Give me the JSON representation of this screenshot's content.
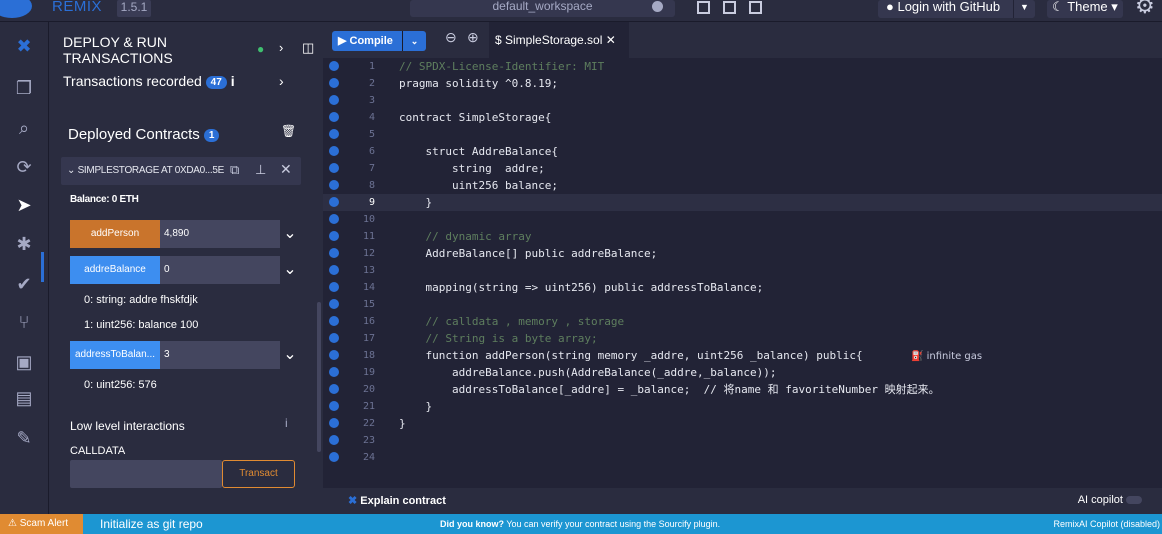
{
  "app": {
    "brand": "REMIX",
    "version": "1.5.1",
    "workspace": "default_workspace",
    "login": "Login with GitHub",
    "theme": "Theme"
  },
  "panel": {
    "title": "DEPLOY & RUN TRANSACTIONS",
    "transactions_label": "Transactions recorded",
    "transactions_count": "47",
    "deployed_label": "Deployed Contracts",
    "deployed_count": "1",
    "instance_title": "SIMPLESTORAGE AT 0XDA0...5E",
    "balance": "Balance: 0 ETH",
    "functions": [
      {
        "name": "addPerson",
        "value": "4,890",
        "color": "#c9742c"
      },
      {
        "name": "addreBalance",
        "value": "0",
        "color": "#3d8ef0"
      },
      {
        "name": "addressToBalan...",
        "value": "3",
        "color": "#3d8ef0"
      }
    ],
    "outputs": {
      "ab0": "0: string: addre fhskfdjk",
      "ab1": "1: uint256: balance 100",
      "atb0": "0: uint256: 576"
    },
    "low_level": "Low level interactions",
    "calldata": "CALLDATA",
    "transact": "Transact"
  },
  "editor": {
    "compile": "Compile",
    "tab": "SimpleStorage.sol",
    "gas": "infinite gas",
    "lines": [
      {
        "n": "1",
        "t": "// SPDX-License-Identifier: MIT"
      },
      {
        "n": "2",
        "t": "pragma solidity ^0.8.19;"
      },
      {
        "n": "3",
        "t": ""
      },
      {
        "n": "4",
        "t": "contract SimpleStorage{"
      },
      {
        "n": "5",
        "t": ""
      },
      {
        "n": "6",
        "t": "    struct AddreBalance{"
      },
      {
        "n": "7",
        "t": "        string  addre;"
      },
      {
        "n": "8",
        "t": "        uint256 balance;"
      },
      {
        "n": "9",
        "t": "    }"
      },
      {
        "n": "10",
        "t": ""
      },
      {
        "n": "11",
        "t": "    // dynamic array"
      },
      {
        "n": "12",
        "t": "    AddreBalance[] public addreBalance;"
      },
      {
        "n": "13",
        "t": ""
      },
      {
        "n": "14",
        "t": "    mapping(string => uint256) public addressToBalance;"
      },
      {
        "n": "15",
        "t": ""
      },
      {
        "n": "16",
        "t": "    // calldata , memory , storage"
      },
      {
        "n": "17",
        "t": "    // String is a byte array;"
      },
      {
        "n": "18",
        "t": "    function addPerson(string memory _addre, uint256 _balance) public{"
      },
      {
        "n": "19",
        "t": "        addreBalance.push(AddreBalance(_addre,_balance));"
      },
      {
        "n": "20",
        "t": "        addressToBalance[_addre] = _balance;  // 将name 和 favoriteNumber 映射起来。"
      },
      {
        "n": "21",
        "t": "    }"
      },
      {
        "n": "22",
        "t": "}"
      },
      {
        "n": "23",
        "t": ""
      },
      {
        "n": "24",
        "t": ""
      }
    ],
    "explain": "Explain contract",
    "ai_copilot": "AI copilot"
  },
  "status": {
    "scam": "Scam Alert",
    "git": "Initialize as git repo",
    "did_you_know": "Did you know?",
    "tip": "You can verify your contract using the Sourcify plugin.",
    "remixai": "RemixAI Copilot (disabled)"
  }
}
